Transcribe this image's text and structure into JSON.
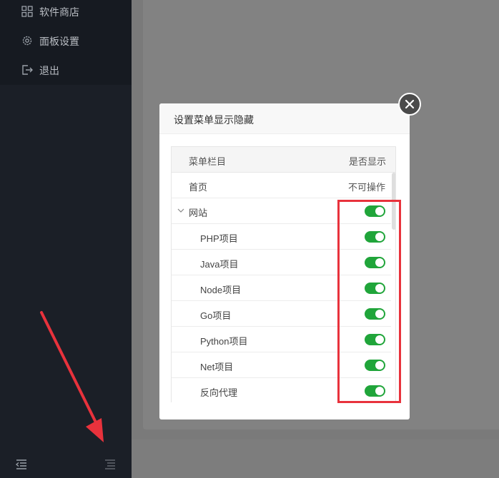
{
  "sidebar": {
    "items": [
      {
        "label": "软件商店",
        "icon": "grid-icon"
      },
      {
        "label": "面板设置",
        "icon": "gear-icon"
      },
      {
        "label": "退出",
        "icon": "logout-icon"
      }
    ],
    "bottom_icons": [
      "collapse-menu-icon",
      "menu-list-icon"
    ]
  },
  "dialog": {
    "title": "设置菜单显示隐藏",
    "columns": {
      "name": "菜单栏目",
      "visible": "是否显示"
    },
    "rows": [
      {
        "name": "首页",
        "status": "不可操作",
        "toggle": false
      },
      {
        "name": "网站",
        "toggle": true,
        "on": true,
        "expandable": true
      },
      {
        "name": "PHP项目",
        "toggle": true,
        "on": true
      },
      {
        "name": "Java项目",
        "toggle": true,
        "on": true
      },
      {
        "name": "Node项目",
        "toggle": true,
        "on": true
      },
      {
        "name": "Go项目",
        "toggle": true,
        "on": true
      },
      {
        "name": "Python项目",
        "toggle": true,
        "on": true
      },
      {
        "name": "Net项目",
        "toggle": true,
        "on": true
      },
      {
        "name": "反向代理",
        "toggle": true,
        "on": true
      }
    ]
  },
  "colors": {
    "toggle_on": "#20a53a",
    "annotation": "#e8323c",
    "sidebar_bg": "#1b1f27"
  }
}
